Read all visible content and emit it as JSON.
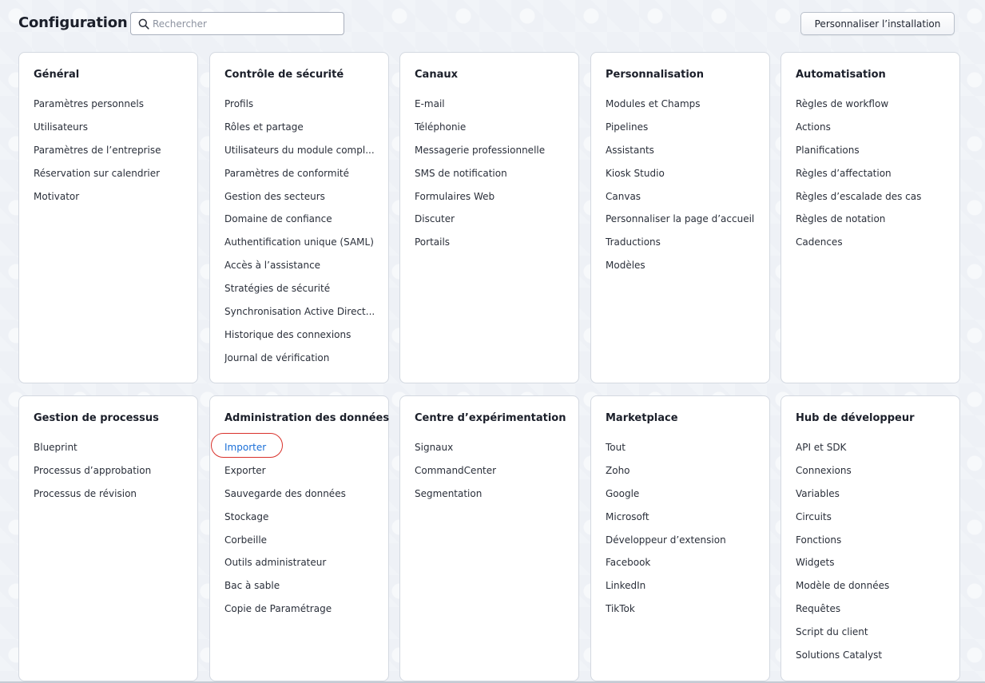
{
  "header": {
    "title": "Configuration",
    "search_placeholder": "Rechercher",
    "customize_label": "Personnaliser l’installation"
  },
  "sections": [
    {
      "title": "Général",
      "items": [
        "Paramètres personnels",
        "Utilisateurs",
        "Paramètres de l’entreprise",
        "Réservation sur calendrier",
        "Motivator"
      ]
    },
    {
      "title": "Contrôle de sécurité",
      "items": [
        "Profils",
        "Rôles et partage",
        "Utilisateurs du module compl...",
        "Paramètres de conformité",
        "Gestion des secteurs",
        "Domaine de confiance",
        "Authentification unique (SAML)",
        "Accès à l’assistance",
        "Stratégies de sécurité",
        "Synchronisation Active Direct...",
        "Historique des connexions",
        "Journal de vérification"
      ]
    },
    {
      "title": "Canaux",
      "items": [
        "E-mail",
        "Téléphonie",
        "Messagerie professionnelle",
        "SMS de notification",
        "Formulaires Web",
        "Discuter",
        "Portails"
      ]
    },
    {
      "title": "Personnalisation",
      "items": [
        "Modules et Champs",
        "Pipelines",
        "Assistants",
        "Kiosk Studio",
        "Canvas",
        "Personnaliser la page d’accueil",
        "Traductions",
        "Modèles"
      ]
    },
    {
      "title": "Automatisation",
      "items": [
        "Règles de workflow",
        "Actions",
        "Planifications",
        "Règles d’affectation",
        "Règles d’escalade des cas",
        "Règles de notation",
        "Cadences"
      ]
    },
    {
      "title": "Gestion de processus",
      "items": [
        "Blueprint",
        "Processus d’approbation",
        "Processus de révision"
      ]
    },
    {
      "title": "Administration des données",
      "items": [
        "Importer",
        "Exporter",
        "Sauvegarde des données",
        "Stockage",
        "Corbeille",
        "Outils administrateur",
        "Bac à sable",
        "Copie de Paramétrage"
      ]
    },
    {
      "title": "Centre d’expérimentation",
      "items": [
        "Signaux",
        "CommandCenter",
        "Segmentation"
      ]
    },
    {
      "title": "Marketplace",
      "items": [
        "Tout",
        "Zoho",
        "Google",
        "Microsoft",
        "Développeur d’extension",
        "Facebook",
        "LinkedIn",
        "TikTok"
      ]
    },
    {
      "title": "Hub de développeur",
      "items": [
        "API et SDK",
        "Connexions",
        "Variables",
        "Circuits",
        "Fonctions",
        "Widgets",
        "Modèle de données",
        "Requêtes",
        "Script du client",
        "Solutions Catalyst"
      ]
    }
  ],
  "highlighted_item": "Importer",
  "colors": {
    "link_active": "#1a6fd8",
    "highlight_ring": "#d9312b",
    "background": "#eef1f6"
  }
}
